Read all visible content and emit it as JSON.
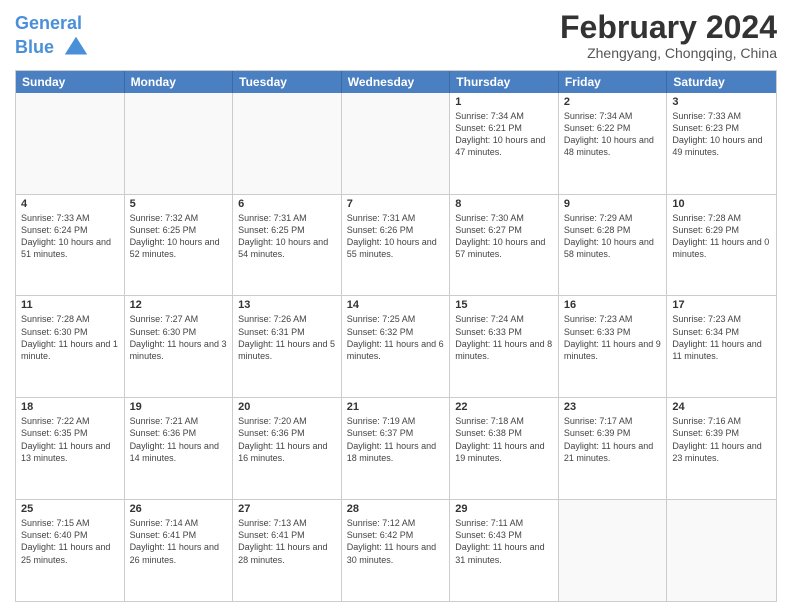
{
  "header": {
    "logo_line1": "General",
    "logo_line2": "Blue",
    "month_year": "February 2024",
    "location": "Zhengyang, Chongqing, China"
  },
  "weekdays": [
    "Sunday",
    "Monday",
    "Tuesday",
    "Wednesday",
    "Thursday",
    "Friday",
    "Saturday"
  ],
  "rows": [
    [
      {
        "day": "",
        "info": ""
      },
      {
        "day": "",
        "info": ""
      },
      {
        "day": "",
        "info": ""
      },
      {
        "day": "",
        "info": ""
      },
      {
        "day": "1",
        "info": "Sunrise: 7:34 AM\nSunset: 6:21 PM\nDaylight: 10 hours and 47 minutes."
      },
      {
        "day": "2",
        "info": "Sunrise: 7:34 AM\nSunset: 6:22 PM\nDaylight: 10 hours and 48 minutes."
      },
      {
        "day": "3",
        "info": "Sunrise: 7:33 AM\nSunset: 6:23 PM\nDaylight: 10 hours and 49 minutes."
      }
    ],
    [
      {
        "day": "4",
        "info": "Sunrise: 7:33 AM\nSunset: 6:24 PM\nDaylight: 10 hours and 51 minutes."
      },
      {
        "day": "5",
        "info": "Sunrise: 7:32 AM\nSunset: 6:25 PM\nDaylight: 10 hours and 52 minutes."
      },
      {
        "day": "6",
        "info": "Sunrise: 7:31 AM\nSunset: 6:25 PM\nDaylight: 10 hours and 54 minutes."
      },
      {
        "day": "7",
        "info": "Sunrise: 7:31 AM\nSunset: 6:26 PM\nDaylight: 10 hours and 55 minutes."
      },
      {
        "day": "8",
        "info": "Sunrise: 7:30 AM\nSunset: 6:27 PM\nDaylight: 10 hours and 57 minutes."
      },
      {
        "day": "9",
        "info": "Sunrise: 7:29 AM\nSunset: 6:28 PM\nDaylight: 10 hours and 58 minutes."
      },
      {
        "day": "10",
        "info": "Sunrise: 7:28 AM\nSunset: 6:29 PM\nDaylight: 11 hours and 0 minutes."
      }
    ],
    [
      {
        "day": "11",
        "info": "Sunrise: 7:28 AM\nSunset: 6:30 PM\nDaylight: 11 hours and 1 minute."
      },
      {
        "day": "12",
        "info": "Sunrise: 7:27 AM\nSunset: 6:30 PM\nDaylight: 11 hours and 3 minutes."
      },
      {
        "day": "13",
        "info": "Sunrise: 7:26 AM\nSunset: 6:31 PM\nDaylight: 11 hours and 5 minutes."
      },
      {
        "day": "14",
        "info": "Sunrise: 7:25 AM\nSunset: 6:32 PM\nDaylight: 11 hours and 6 minutes."
      },
      {
        "day": "15",
        "info": "Sunrise: 7:24 AM\nSunset: 6:33 PM\nDaylight: 11 hours and 8 minutes."
      },
      {
        "day": "16",
        "info": "Sunrise: 7:23 AM\nSunset: 6:33 PM\nDaylight: 11 hours and 9 minutes."
      },
      {
        "day": "17",
        "info": "Sunrise: 7:23 AM\nSunset: 6:34 PM\nDaylight: 11 hours and 11 minutes."
      }
    ],
    [
      {
        "day": "18",
        "info": "Sunrise: 7:22 AM\nSunset: 6:35 PM\nDaylight: 11 hours and 13 minutes."
      },
      {
        "day": "19",
        "info": "Sunrise: 7:21 AM\nSunset: 6:36 PM\nDaylight: 11 hours and 14 minutes."
      },
      {
        "day": "20",
        "info": "Sunrise: 7:20 AM\nSunset: 6:36 PM\nDaylight: 11 hours and 16 minutes."
      },
      {
        "day": "21",
        "info": "Sunrise: 7:19 AM\nSunset: 6:37 PM\nDaylight: 11 hours and 18 minutes."
      },
      {
        "day": "22",
        "info": "Sunrise: 7:18 AM\nSunset: 6:38 PM\nDaylight: 11 hours and 19 minutes."
      },
      {
        "day": "23",
        "info": "Sunrise: 7:17 AM\nSunset: 6:39 PM\nDaylight: 11 hours and 21 minutes."
      },
      {
        "day": "24",
        "info": "Sunrise: 7:16 AM\nSunset: 6:39 PM\nDaylight: 11 hours and 23 minutes."
      }
    ],
    [
      {
        "day": "25",
        "info": "Sunrise: 7:15 AM\nSunset: 6:40 PM\nDaylight: 11 hours and 25 minutes."
      },
      {
        "day": "26",
        "info": "Sunrise: 7:14 AM\nSunset: 6:41 PM\nDaylight: 11 hours and 26 minutes."
      },
      {
        "day": "27",
        "info": "Sunrise: 7:13 AM\nSunset: 6:41 PM\nDaylight: 11 hours and 28 minutes."
      },
      {
        "day": "28",
        "info": "Sunrise: 7:12 AM\nSunset: 6:42 PM\nDaylight: 11 hours and 30 minutes."
      },
      {
        "day": "29",
        "info": "Sunrise: 7:11 AM\nSunset: 6:43 PM\nDaylight: 11 hours and 31 minutes."
      },
      {
        "day": "",
        "info": ""
      },
      {
        "day": "",
        "info": ""
      }
    ]
  ]
}
